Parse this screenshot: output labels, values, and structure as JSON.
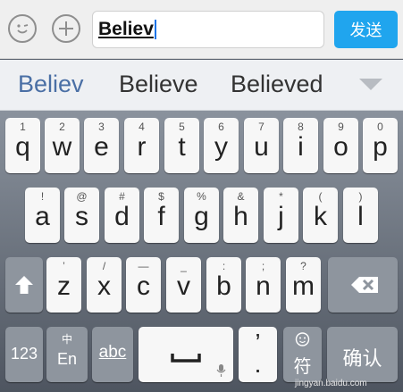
{
  "input_bar": {
    "text": "Believ",
    "send_label": "发送"
  },
  "suggestions": [
    "Believ",
    "Believe",
    "Believed"
  ],
  "keyboard": {
    "row1": [
      {
        "sub": "1",
        "main": "q"
      },
      {
        "sub": "2",
        "main": "w"
      },
      {
        "sub": "3",
        "main": "e"
      },
      {
        "sub": "4",
        "main": "r"
      },
      {
        "sub": "5",
        "main": "t"
      },
      {
        "sub": "6",
        "main": "y"
      },
      {
        "sub": "7",
        "main": "u"
      },
      {
        "sub": "8",
        "main": "i"
      },
      {
        "sub": "9",
        "main": "o"
      },
      {
        "sub": "0",
        "main": "p"
      }
    ],
    "row2": [
      {
        "sub": "!",
        "main": "a"
      },
      {
        "sub": "@",
        "main": "s"
      },
      {
        "sub": "#",
        "main": "d"
      },
      {
        "sub": "$",
        "main": "f"
      },
      {
        "sub": "%",
        "main": "g"
      },
      {
        "sub": "&",
        "main": "h"
      },
      {
        "sub": "*",
        "main": "j"
      },
      {
        "sub": "(",
        "main": "k"
      },
      {
        "sub": ")",
        "main": "l"
      }
    ],
    "row3": [
      {
        "sub": "’",
        "main": "z"
      },
      {
        "sub": "/",
        "main": "x"
      },
      {
        "sub": "—",
        "main": "c"
      },
      {
        "sub": "_",
        "main": "v"
      },
      {
        "sub": ":",
        "main": "b"
      },
      {
        "sub": ";",
        "main": "n"
      },
      {
        "sub": "?",
        "main": "m"
      }
    ],
    "bottom": {
      "num_label": "123",
      "lang_top": "中",
      "lang_bottom": "En",
      "abc_label": "abc",
      "comma_label": "’",
      "period_label": ".",
      "symbol_label": "符",
      "confirm_label": "确认"
    }
  },
  "watermark": "jingyan.baidu.com"
}
